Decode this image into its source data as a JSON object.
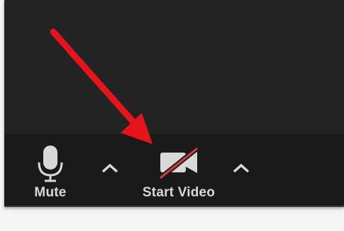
{
  "toolbar": {
    "mute_label": "Mute",
    "video_label": "Start Video"
  },
  "icons": {
    "microphone": "microphone-icon",
    "camera_off": "video-camera-off-icon",
    "caret_up": "chevron-up-icon"
  },
  "colors": {
    "background": "#232323",
    "toolbar": "#1a1a1a",
    "label": "#d8d8d8",
    "strike": "#d83b3b",
    "arrow": "#e8141c"
  }
}
